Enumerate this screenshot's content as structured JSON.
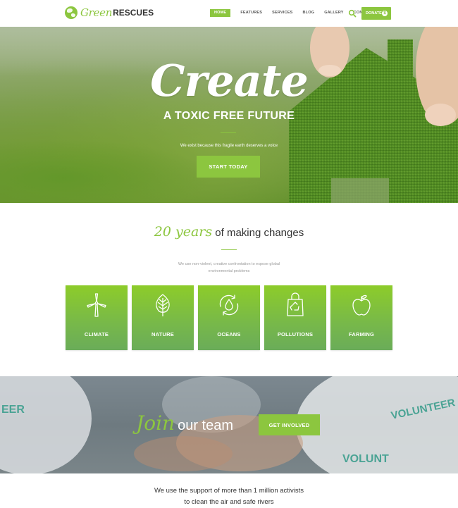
{
  "header": {
    "logo_green": "Green",
    "logo_rescues": "RESCUES",
    "nav": [
      "HOME",
      "FEATURES",
      "SERVICES",
      "BLOG",
      "GALLERY",
      "CONTACTS"
    ],
    "active_nav": "HOME",
    "donate_label": "DONATE",
    "donate_symbol": "$"
  },
  "hero": {
    "title": "Create",
    "subtitle": "A TOXIC FREE FUTURE",
    "description": "We exist because this fragile earth deserves a voice",
    "button_label": "START TODAY"
  },
  "intro": {
    "years": "20 years",
    "heading_rest": "of making changes",
    "description": "We use non-violent, creative confrontation to expose global environmental problems"
  },
  "cards": [
    {
      "label": "CLIMATE",
      "icon": "wind-turbine-icon"
    },
    {
      "label": "NATURE",
      "icon": "leaf-icon"
    },
    {
      "label": "OCEANS",
      "icon": "water-drop-recycle-icon"
    },
    {
      "label": "POLLUTIONS",
      "icon": "recycle-bag-icon"
    },
    {
      "label": "FARMING",
      "icon": "apple-icon"
    }
  ],
  "join": {
    "script": "Join",
    "rest": "our team",
    "button_label": "GET INVOLVED",
    "shirt_texts": [
      "EER",
      "VOLUNTEER",
      "VOLUNT"
    ]
  },
  "bottom": {
    "line1": "We use the support of more than 1 million activists",
    "line2": "to clean the air and safe rivers"
  },
  "colors": {
    "accent": "#8cc63f",
    "text_dark": "#333333",
    "text_muted": "#999999"
  }
}
